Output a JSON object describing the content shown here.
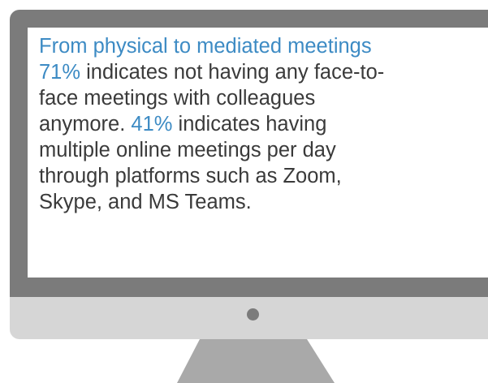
{
  "heading": "From physical to mediated meetings",
  "body": {
    "line1_stat": "71%",
    "line1_rest": " indicates not having any face-to-",
    "line2": "face meetings with colleagues",
    "line3_start": "anymore. ",
    "line3_stat": "41%",
    "line3_rest": " indicates having",
    "line4": "multiple online meetings per day",
    "line5": "through platforms such as Zoom,",
    "line6": "Skype, and MS Teams."
  },
  "colors": {
    "accent": "#3d8bc4",
    "bezel": "#7b7b7b",
    "chin": "#d6d6d6",
    "stand": "#a9a9a9",
    "text": "#3a3a3a"
  },
  "icons": {
    "power_indicator": "power-dot-icon"
  }
}
